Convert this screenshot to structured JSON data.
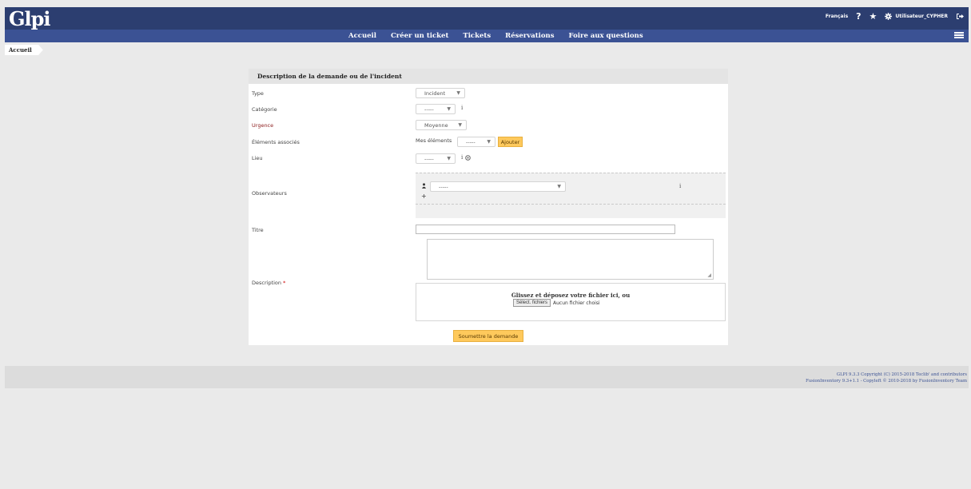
{
  "header": {
    "logo": "Glpi",
    "language": "Français",
    "help_icon": "?",
    "star_icon": "★",
    "user": "Utilisateur_CYPHER",
    "nav": [
      "Accueil",
      "Créer un ticket",
      "Tickets",
      "Réservations",
      "Foire aux questions"
    ]
  },
  "breadcrumb": {
    "home": "Accueil"
  },
  "form": {
    "title": "Description de la demande ou de l'incident",
    "type_label": "Type",
    "type_value": "Incident",
    "category_label": "Catégorie",
    "category_value": "-----",
    "urgency_label": "Urgence",
    "urgency_value": "Moyenne",
    "associated_label": "Éléments associés",
    "my_items_label": "Mes éléments",
    "my_items_value": "-----",
    "add_button": "Ajouter",
    "location_label": "Lieu",
    "location_value": "-----",
    "observers_label": "Observateurs",
    "observers_value": "-----",
    "add_icon": "+",
    "info_icon": "i",
    "title_label": "Titre",
    "title_value": "",
    "description_label": "Description",
    "required_mark": "*",
    "drop_text": "Glissez et déposez votre fichier ici, ou",
    "select_files": "Sélect. fichiers",
    "no_file": "Aucun fichier choisi",
    "submit": "Soumettre la demande"
  },
  "footer": {
    "line1": "GLPI 9.3.3 Copyright (C) 2015-2018 Teclib' and contributors",
    "line2": "FusionInventory 9.3+1.1 - Copyleft © 2010-2018 by FusionInventory Team"
  },
  "colors": {
    "header": "#2c3e70",
    "nav_band": "#3b5294",
    "accent": "#fec95c"
  }
}
